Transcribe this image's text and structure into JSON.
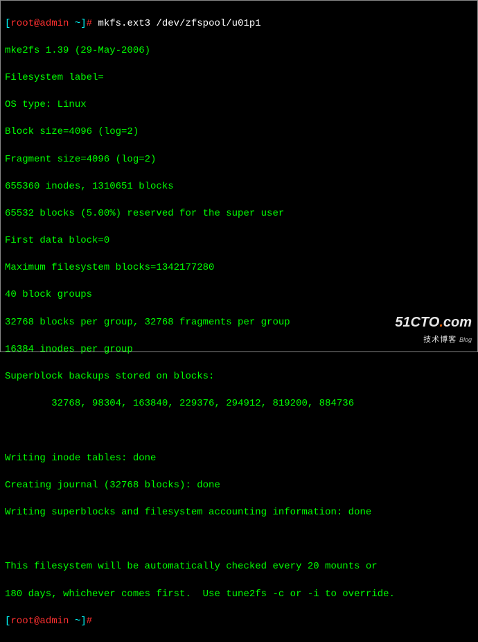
{
  "prompt1": {
    "bracket_open": "[",
    "user": "root@admin ",
    "tilde": "~",
    "bracket_close": "]",
    "symbol": "#",
    "space": " ",
    "command": "mkfs.ext3 /dev/zfspool/u01p1"
  },
  "output": {
    "line1": "mke2fs 1.39 (29-May-2006)",
    "line2": "Filesystem label=",
    "line3": "OS type: Linux",
    "line4": "Block size=4096 (log=2)",
    "line5": "Fragment size=4096 (log=2)",
    "line6": "655360 inodes, 1310651 blocks",
    "line7": "65532 blocks (5.00%) reserved for the super user",
    "line8": "First data block=0",
    "line9": "Maximum filesystem blocks=1342177280",
    "line10": "40 block groups",
    "line11": "32768 blocks per group, 32768 fragments per group",
    "line12": "16384 inodes per group",
    "line13": "Superblock backups stored on blocks: ",
    "line14": "        32768, 98304, 163840, 229376, 294912, 819200, 884736",
    "line15": "Writing inode tables: done                            ",
    "line16": "Creating journal (32768 blocks): done",
    "line17": "Writing superblocks and filesystem accounting information: done",
    "line18": "This filesystem will be automatically checked every 20 mounts or",
    "line19": "180 days, whichever comes first.  Use tune2fs -c or -i to override."
  },
  "prompt2": {
    "bracket_open": "[",
    "user": "root@admin ",
    "tilde": "~",
    "bracket_close": "]",
    "symbol": "#"
  },
  "watermark": {
    "main_pre": "51CTO",
    "main_dot": ".",
    "main_post": "com",
    "sub": "技术博客",
    "tag": "Blog"
  }
}
